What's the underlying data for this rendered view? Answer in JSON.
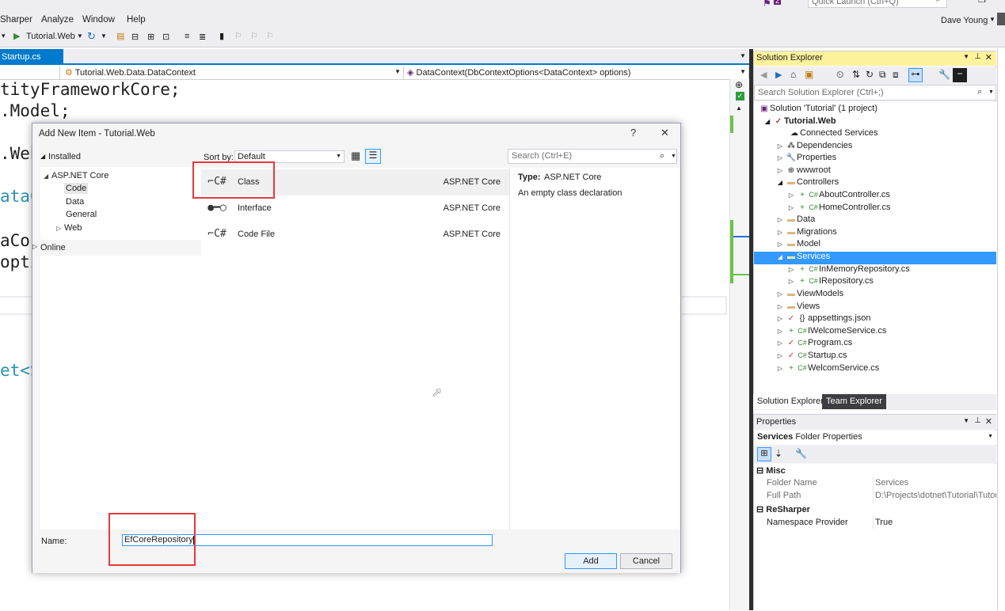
{
  "menu": [
    "Sharper",
    "Analyze",
    "Window",
    "Help"
  ],
  "quick_launch_placeholder": "Quick Launch (Ctrl+Q)",
  "notification_count": "2",
  "user_name": "Dave Young",
  "run_target": "Tutorial.Web",
  "editor": {
    "tab": "Startup.cs",
    "nav_left": "Tutorial.Web.Data.DataContext",
    "nav_right": "DataContext(DbContextOptions<DataContext> options)",
    "lines": [
      {
        "text": "tityFrameworkCore;",
        "color": "#1e1e1e"
      },
      {
        "text": ".Model;",
        "color": "#1e1e1e"
      },
      {
        "text": ".Web",
        "color": "#1e1e1e"
      },
      {
        "text": "ataC",
        "color": "#2b91af"
      },
      {
        "text": "aCor",
        "color": "#1e1e1e"
      },
      {
        "text": "opti",
        "color": "#1e1e1e"
      },
      {
        "text": "et<S",
        "color": "#2b91af"
      }
    ]
  },
  "dialog": {
    "title": "Add New Item - Tutorial.Web",
    "help": "?",
    "close": "✕",
    "installed": "Installed",
    "tree": [
      "ASP.NET Core",
      "Code",
      "Data",
      "General",
      "Web"
    ],
    "online": "Online",
    "sort_label": "Sort by:",
    "sort_value": "Default",
    "search_placeholder": "Search (Ctrl+E)",
    "templates": [
      {
        "name": "Class",
        "lang": "ASP.NET Core",
        "icon": "class-icon"
      },
      {
        "name": "Interface",
        "lang": "ASP.NET Core",
        "icon": "interface-icon"
      },
      {
        "name": "Code File",
        "lang": "ASP.NET Core",
        "icon": "code-file-icon"
      }
    ],
    "type_label": "Type:",
    "type_value": "ASP.NET Core",
    "description": "An empty class declaration",
    "name_label": "Name:",
    "name_value": "EfCoreRepository",
    "add": "Add",
    "cancel": "Cancel"
  },
  "solution_explorer": {
    "title": "Solution Explorer",
    "search_placeholder": "Search Solution Explorer (Ctrl+;)",
    "items": [
      {
        "label": "Solution 'Tutorial' (1 project)",
        "bold": false
      },
      {
        "label": "Tutorial.Web",
        "bold": true
      },
      {
        "label": "Connected Services",
        "bold": false
      },
      {
        "label": "Dependencies",
        "bold": false
      },
      {
        "label": "Properties",
        "bold": false
      },
      {
        "label": "wwwroot",
        "bold": false
      },
      {
        "label": "Controllers",
        "bold": false
      },
      {
        "label": "AboutController.cs",
        "bold": false
      },
      {
        "label": "HomeController.cs",
        "bold": false
      },
      {
        "label": "Data",
        "bold": false
      },
      {
        "label": "Migrations",
        "bold": false
      },
      {
        "label": "Model",
        "bold": false
      },
      {
        "label": "Services",
        "bold": false
      },
      {
        "label": "InMemoryRepository.cs",
        "bold": false
      },
      {
        "label": "IRepository.cs",
        "bold": false
      },
      {
        "label": "ViewModels",
        "bold": false
      },
      {
        "label": "Views",
        "bold": false
      },
      {
        "label": "appsettings.json",
        "bold": false
      },
      {
        "label": "IWelcomeService.cs",
        "bold": false
      },
      {
        "label": "Program.cs",
        "bold": false
      },
      {
        "label": "Startup.cs",
        "bold": false
      },
      {
        "label": "WelcomService.cs",
        "bold": false
      }
    ],
    "tab_active": "Solution Explorer",
    "tab_other": "Team Explorer"
  },
  "properties": {
    "title": "Properties",
    "object_name": "Services",
    "object_type": "Folder Properties",
    "cat_misc": "Misc",
    "folder_name_label": "Folder Name",
    "folder_name_value": "Services",
    "full_path_label": "Full Path",
    "full_path_value": "D:\\Projects\\dotnet\\Tutorial\\Tutor",
    "cat_resharper": "ReSharper",
    "ns_label": "Namespace Provider",
    "ns_value": "True"
  }
}
